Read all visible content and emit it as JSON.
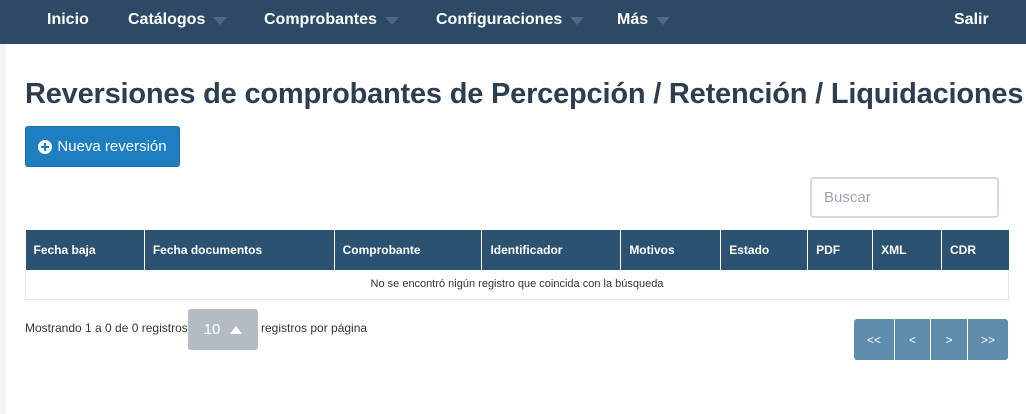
{
  "navbar": {
    "items": [
      {
        "label": "Inicio",
        "dropdown": false
      },
      {
        "label": "Catálogos",
        "dropdown": true
      },
      {
        "label": "Comprobantes",
        "dropdown": true
      },
      {
        "label": "Configuraciones",
        "dropdown": true
      },
      {
        "label": "Más",
        "dropdown": true
      }
    ],
    "logout_label": "Salir",
    "background_color": "#2c4a66"
  },
  "page": {
    "title": "Reversiones de comprobantes de Percepción / Retención / Liquidaciones",
    "new_button_label": "Nueva reversión",
    "search_placeholder": "Buscar"
  },
  "table": {
    "columns": [
      "Fecha baja",
      "Fecha documentos",
      "Comprobante",
      "Identificador",
      "Motivos",
      "Estado",
      "PDF",
      "XML",
      "CDR"
    ],
    "rows": [],
    "empty_message": "No se encontró nigún registro que coincida con la búsqueda"
  },
  "pagination": {
    "showing_text": "Mostrando 1 a 0 de 0 registros",
    "page_size": "10",
    "per_page_text": "registros por página",
    "buttons": [
      "<<",
      "<",
      ">",
      ">>"
    ]
  }
}
